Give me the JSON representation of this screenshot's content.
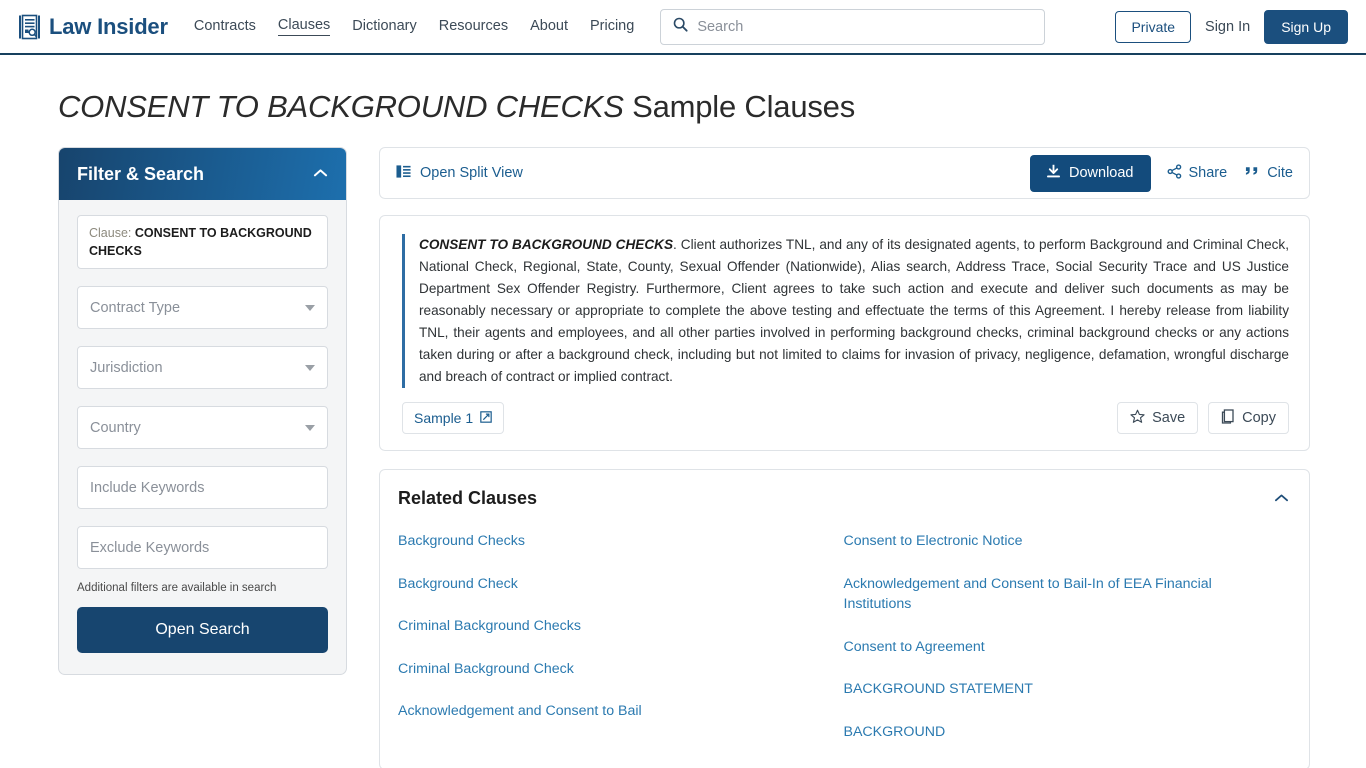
{
  "header": {
    "brand": "Law Insider",
    "brand_icon": "document-search-icon",
    "nav": [
      {
        "label": "Contracts",
        "active": false
      },
      {
        "label": "Clauses",
        "active": true
      },
      {
        "label": "Dictionary",
        "active": false
      },
      {
        "label": "Resources",
        "active": false
      },
      {
        "label": "About",
        "active": false
      },
      {
        "label": "Pricing",
        "active": false
      }
    ],
    "search": {
      "placeholder": "Search",
      "value": "",
      "icon": "search-icon"
    },
    "private_label": "Private",
    "signin_label": "Sign In",
    "signup_label": "Sign Up"
  },
  "title": {
    "clause_name": "CONSENT TO BACKGROUND CHECKS",
    "suffix": "Sample Clauses"
  },
  "sidebar": {
    "heading": "Filter & Search",
    "collapse_icon": "chevron-up-icon",
    "chip": {
      "label": "Clause:",
      "value": "CONSENT TO BACKGROUND CHECKS"
    },
    "selects": [
      {
        "placeholder": "Contract Type"
      },
      {
        "placeholder": "Jurisdiction"
      },
      {
        "placeholder": "Country"
      }
    ],
    "inputs": [
      {
        "placeholder": "Include Keywords",
        "value": ""
      },
      {
        "placeholder": "Exclude Keywords",
        "value": ""
      }
    ],
    "note": "Additional filters are available in search",
    "open_search_label": "Open Search"
  },
  "toolbar": {
    "split_view_label": "Open Split View",
    "split_view_icon": "split-view-icon",
    "download_label": "Download",
    "download_icon": "download-icon",
    "share_label": "Share",
    "share_icon": "share-icon",
    "cite_label": "Cite",
    "cite_icon": "quote-icon"
  },
  "clause": {
    "lead": "CONSENT TO BACKGROUND CHECKS",
    "body": ". Client authorizes TNL, and any of its designated agents, to perform Background and Criminal Check, National Check, Regional, State, County, Sexual Offender (Nationwide), Alias search, Address Trace, Social Security Trace and US Justice Department Sex Offender Registry. Furthermore, Client agrees to take such action and execute and deliver such documents as may be reasonably necessary or appropriate to complete the above testing and effectuate the terms of this Agreement. I hereby release from liability TNL, their agents and employees, and all other parties involved in performing background checks, criminal background checks or any actions taken during or after a background check, including but not limited to claims for invasion of privacy, negligence, defamation, wrongful discharge and breach of contract or implied contract.",
    "sample_label": "Sample 1",
    "sample_icon": "external-link-icon",
    "save_label": "Save",
    "save_icon": "star-icon",
    "copy_label": "Copy",
    "copy_icon": "copy-icon"
  },
  "related": {
    "title": "Related Clauses",
    "collapse_icon": "chevron-up-icon",
    "left_column": [
      "Background Checks",
      "Background Check",
      "Criminal Background Checks",
      "Criminal Background Check",
      "Acknowledgement and Consent to Bail"
    ],
    "right_column": [
      "Consent to Electronic Notice",
      "Acknowledgement and Consent to Bail-In of EEA Financial Institutions",
      "Consent to Agreement",
      "BACKGROUND STATEMENT",
      "BACKGROUND"
    ]
  },
  "colors": {
    "brand_blue": "#1b4f7e",
    "accent_blue": "#2e6da4",
    "link_blue": "#2b7ab0",
    "button_blue": "#134b7c",
    "header_rule": "#17405e"
  }
}
